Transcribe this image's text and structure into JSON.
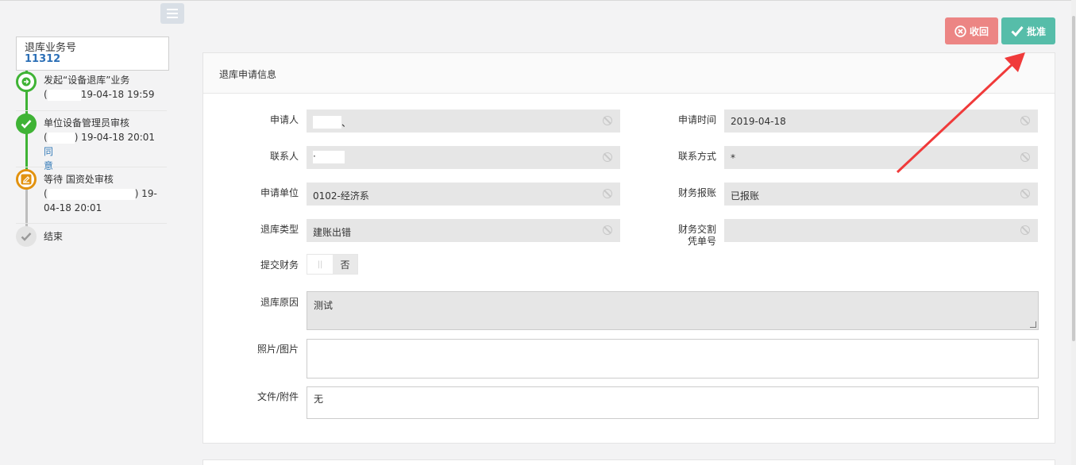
{
  "sidebar": {
    "business_number_label": "退库业务号",
    "business_number": "11312",
    "steps": [
      {
        "title": "发起“设备退库”业务",
        "line2_prefix": "(",
        "line2_suffix": "19-04-18 19:59",
        "status": "start",
        "color": "#3fb335"
      },
      {
        "title": "单位设备管理员审核",
        "line2_prefix": "(",
        "line2_suffix": ") 19-04-18 20:01",
        "link": "同",
        "line3": "意",
        "status": "approved",
        "color": "#3fb335"
      },
      {
        "title": "等待 国资处审核",
        "line2_prefix": "(",
        "line2_suffix": ") 19-",
        "line3": "04-18 20:01",
        "status": "pending",
        "color": "#e2920f"
      },
      {
        "title": "结束",
        "status": "end",
        "color": "#bdbdbd"
      }
    ]
  },
  "actions": {
    "revoke_label": "收回",
    "approve_label": "批准"
  },
  "panel": {
    "title": "退库申请信息"
  },
  "form": {
    "applicant_label": "申请人",
    "applicant_value": "、",
    "apply_time_label": "申请时间",
    "apply_time_value": "2019-04-18",
    "contact_label": "联系人",
    "contact_value": "·",
    "contact_method_label": "联系方式",
    "contact_method_value": "*",
    "apply_unit_label": "申请单位",
    "apply_unit_value": "0102-经济系",
    "finance_reimburse_label": "财务报账",
    "finance_reimburse_value": "已报账",
    "return_type_label": "退库类型",
    "return_type_value": "建账出错",
    "finance_voucher_label_1": "财务交割",
    "finance_voucher_label_2": "凭单号",
    "finance_voucher_value": "",
    "submit_finance_label": "提交财务",
    "submit_finance_toggle_knob": "||",
    "submit_finance_value": "否",
    "return_reason_label": "退库原因",
    "return_reason_value": "测试",
    "photos_label": "照片/图片",
    "files_label": "文件/附件",
    "files_value": "无"
  },
  "colors": {
    "revoke": "#ec8584",
    "approve": "#56bda9",
    "link": "#337ab7",
    "annotation_arrow": "#f03a3a"
  }
}
